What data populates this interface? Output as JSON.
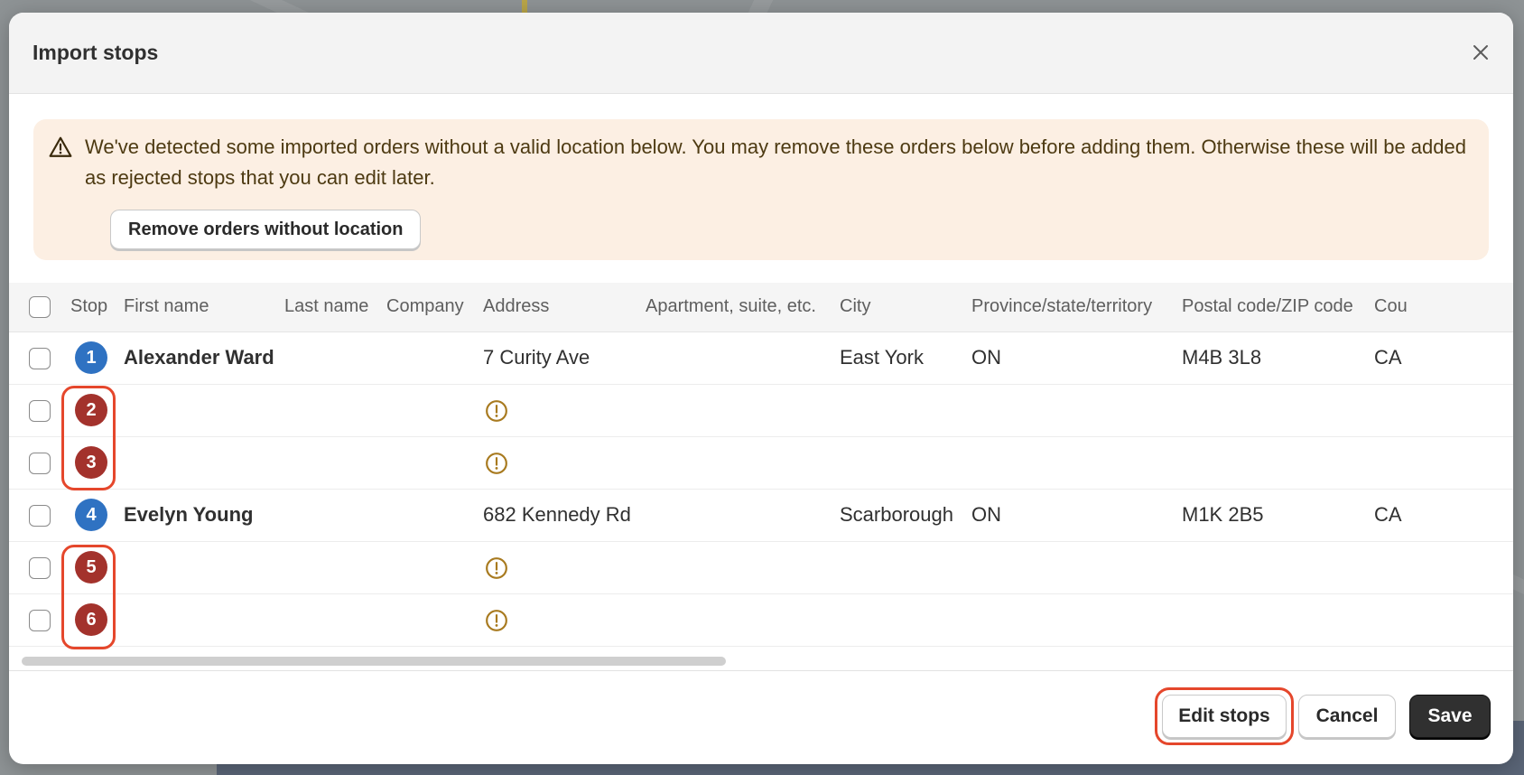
{
  "modal": {
    "title": "Import stops",
    "close_icon": "close-icon"
  },
  "banner": {
    "icon": "warning-triangle-icon",
    "message": "We've detected some imported orders without a valid location below. You may remove these orders below before adding them. Otherwise these will be added as rejected stops that you can edit later.",
    "remove_button": "Remove orders without location"
  },
  "table": {
    "headers": [
      "Stop",
      "First name",
      "Last name",
      "Company",
      "Address",
      "Apartment, suite, etc.",
      "City",
      "Province/state/territory",
      "Postal code/ZIP code",
      "Cou"
    ],
    "rows": [
      {
        "stop": "1",
        "status": "valid",
        "first_name": "Alexander Ward",
        "address": "7 Curity Ave",
        "city": "East York",
        "province": "ON",
        "postal": "M4B 3L8",
        "country": "CA"
      },
      {
        "stop": "2",
        "status": "invalid",
        "first_name": "",
        "address": "",
        "city": "",
        "province": "",
        "postal": "",
        "country": ""
      },
      {
        "stop": "3",
        "status": "invalid",
        "first_name": "",
        "address": "",
        "city": "",
        "province": "",
        "postal": "",
        "country": ""
      },
      {
        "stop": "4",
        "status": "valid",
        "first_name": "Evelyn Young",
        "address": "682 Kennedy Rd",
        "city": "Scarborough",
        "province": "ON",
        "postal": "M1K 2B5",
        "country": "CA"
      },
      {
        "stop": "5",
        "status": "invalid",
        "first_name": "",
        "address": "",
        "city": "",
        "province": "",
        "postal": "",
        "country": ""
      },
      {
        "stop": "6",
        "status": "invalid",
        "first_name": "",
        "address": "",
        "city": "",
        "province": "",
        "postal": "",
        "country": ""
      }
    ]
  },
  "footer": {
    "edit_stops": "Edit stops",
    "cancel": "Cancel",
    "save": "Save"
  },
  "colors": {
    "valid_stop": "#2f72c2",
    "invalid_stop": "#a3322c",
    "highlight": "#e5472c",
    "banner_bg": "#fcefe3",
    "warning_icon": "#a87a1f"
  }
}
